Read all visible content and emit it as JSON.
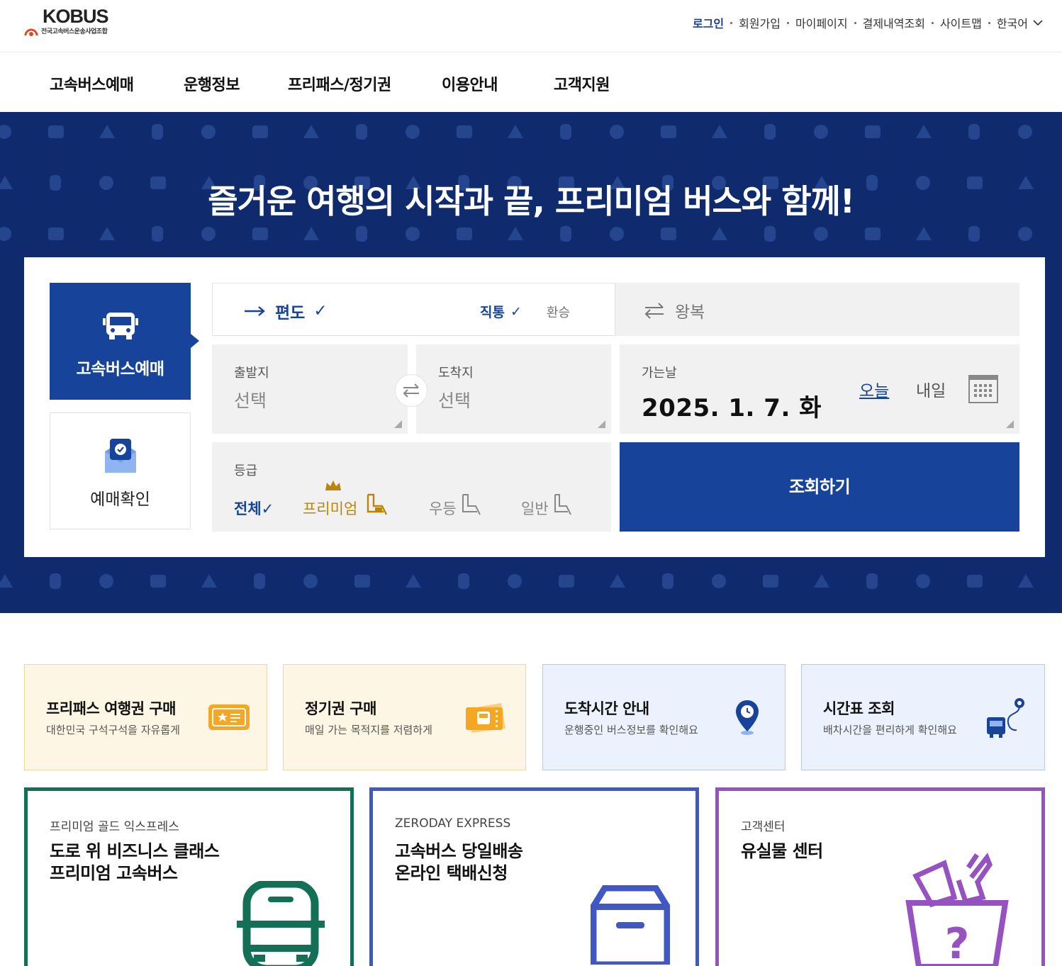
{
  "header": {
    "logo_text": "KOBUS",
    "logo_sub": "전국고속버스운송사업조합",
    "util": {
      "login": "로그인",
      "signup": "회원가입",
      "mypage": "마이페이지",
      "payments": "결제내역조회",
      "sitemap": "사이트맵",
      "language": "한국어"
    }
  },
  "nav": [
    "고속버스예매",
    "운행정보",
    "프리패스/정기권",
    "이용안내",
    "고객지원"
  ],
  "hero": {
    "title": "즐거운 여행의 시작과 끝, 프리미엄 버스와 함께!"
  },
  "booking": {
    "tab_booking": "고속버스예매",
    "tab_check": "예매확인",
    "oneway": "편도",
    "direct": "직통",
    "transfer": "환승",
    "roundtrip": "왕복",
    "departure_label": "출발지",
    "departure_value": "선택",
    "arrival_label": "도착지",
    "arrival_value": "선택",
    "date_label": "가는날",
    "date_value": "2025. 1. 7. 화",
    "today": "오늘",
    "tomorrow": "내일",
    "grade_label": "등급",
    "grade_all": "전체",
    "grade_premium": "프리미엄",
    "grade_excellent": "우등",
    "grade_standard": "일반",
    "search": "조회하기",
    "check_mark": "✓"
  },
  "quick": [
    {
      "title": "프리패스 여행권 구매",
      "desc": "대한민국 구석구석을 자유롭게",
      "icon": "ticket-icon"
    },
    {
      "title": "정기권 구매",
      "desc": "매일 가는 목적지를 저렴하게",
      "icon": "bus-pass-icon"
    },
    {
      "title": "도착시간 안내",
      "desc": "운행중인 버스정보를 확인해요",
      "icon": "location-pin-icon"
    },
    {
      "title": "시간표 조회",
      "desc": "배차시간을 편리하게 확인해요",
      "icon": "bus-route-icon"
    }
  ],
  "promo": [
    {
      "sub": "프리미엄 골드 익스프레스",
      "line1": "도로 위 비즈니스 클래스",
      "line2": "프리미엄 고속버스",
      "color": "#137057",
      "icon": "bus-icon"
    },
    {
      "sub": "ZERODAY EXPRESS",
      "line1": "고속버스 당일배송",
      "line2": "온라인 택배신청",
      "color": "#4157c1",
      "icon": "package-icon"
    },
    {
      "sub": "고객센터",
      "line1": "유실물 센터",
      "line2": "",
      "color": "#9752c2",
      "icon": "lost-item-box-icon"
    }
  ],
  "colors": {
    "brand_blue": "#17449a",
    "hero_bg": "#0f2b6e",
    "premium_gold": "#b8860b"
  }
}
